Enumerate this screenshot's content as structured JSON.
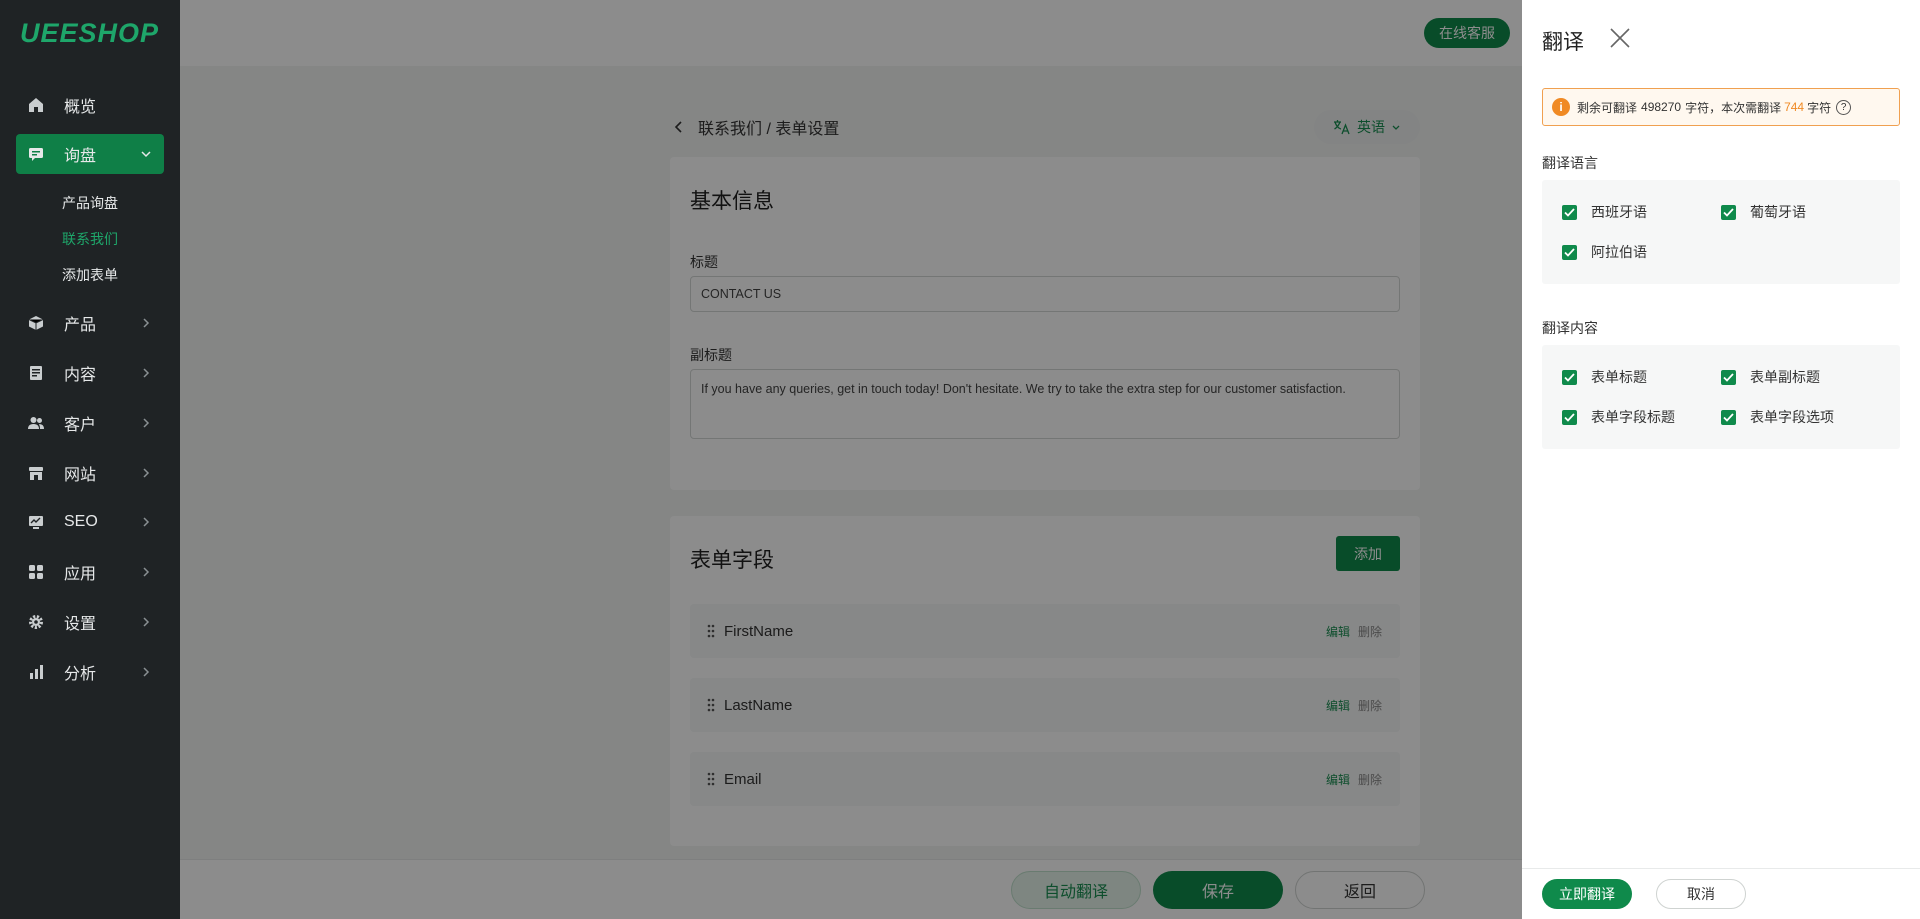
{
  "app": {
    "logo": "UEESHOP",
    "online_service": "在线客服"
  },
  "sidebar": {
    "items": [
      {
        "label": "概览",
        "icon": "home-icon"
      },
      {
        "label": "询盘",
        "icon": "message-icon",
        "active": true
      },
      {
        "label": "产品",
        "icon": "box-icon"
      },
      {
        "label": "内容",
        "icon": "document-icon"
      },
      {
        "label": "客户",
        "icon": "users-icon"
      },
      {
        "label": "网站",
        "icon": "store-icon"
      },
      {
        "label": "SEO",
        "icon": "monitor-icon"
      },
      {
        "label": "应用",
        "icon": "apps-icon"
      },
      {
        "label": "设置",
        "icon": "gear-icon"
      },
      {
        "label": "分析",
        "icon": "bar-chart-icon"
      }
    ],
    "subitems": [
      {
        "label": "产品询盘"
      },
      {
        "label": "联系我们",
        "active": true
      },
      {
        "label": "添加表单"
      }
    ]
  },
  "main": {
    "breadcrumb": "联系我们 / 表单设置",
    "language": "英语",
    "basic": {
      "title": "基本信息",
      "title_label": "标题",
      "title_value": "CONTACT US",
      "subtitle_label": "副标题",
      "subtitle_value": "If you have any queries, get in touch today! Don't hesitate. We try to take the extra step for our customer satisfaction."
    },
    "fields": {
      "title": "表单字段",
      "add_label": "添加",
      "edit_label": "编辑",
      "delete_label": "删除",
      "rows": [
        {
          "name": "FirstName"
        },
        {
          "name": "LastName"
        },
        {
          "name": "Email"
        }
      ]
    },
    "actions": {
      "auto_translate": "自动翻译",
      "save": "保存",
      "back": "返回"
    }
  },
  "drawer": {
    "title": "翻译",
    "notice": {
      "prefix": "剩余可翻译",
      "remaining": "498270",
      "middle": "字符，本次需翻译",
      "needed": "744",
      "suffix": "字符"
    },
    "languages_label": "翻译语言",
    "languages": [
      {
        "label": "西班牙语",
        "checked": true
      },
      {
        "label": "葡萄牙语",
        "checked": true
      },
      {
        "label": "阿拉伯语",
        "checked": true
      }
    ],
    "content_label": "翻译内容",
    "contents": [
      {
        "label": "表单标题",
        "checked": true
      },
      {
        "label": "表单副标题",
        "checked": true
      },
      {
        "label": "表单字段标题",
        "checked": true
      },
      {
        "label": "表单字段选项",
        "checked": true
      }
    ],
    "translate_now": "立即翻译",
    "cancel": "取消"
  },
  "colors": {
    "brand": "#0f8a4b",
    "sidebar_bg": "#1f2325",
    "warning": "#f08a24"
  }
}
